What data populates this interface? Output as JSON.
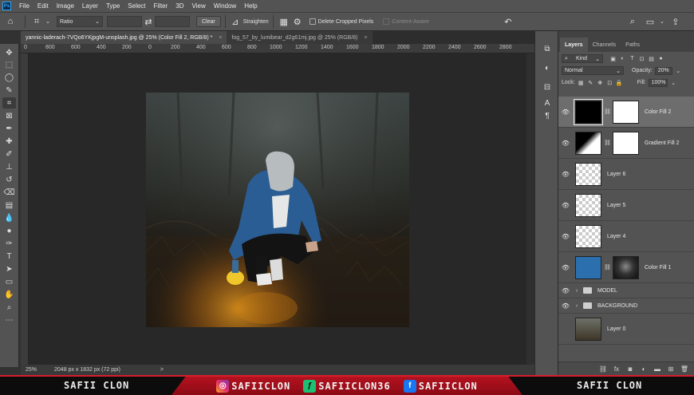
{
  "app": {
    "logo": "Ps"
  },
  "menu": [
    "File",
    "Edit",
    "Image",
    "Layer",
    "Type",
    "Select",
    "Filter",
    "3D",
    "View",
    "Window",
    "Help"
  ],
  "options_bar": {
    "ratio_label": "Ratio",
    "clear_label": "Clear",
    "straighten_label": "Straighten",
    "delete_cropped_label": "Delete Cropped Pixels",
    "content_aware_label": "Content-Aware"
  },
  "tabs": [
    {
      "label": "yannic-laderach-7VQo6YKjpgM-unsplash.jpg @ 25% (Color Fill 2, RGB/8) *",
      "close": "×"
    },
    {
      "label": "fog_57_by_lumibear_d2g61mj.jpg @ 25% (RGB/8)",
      "close": "×"
    }
  ],
  "ruler": [
    "0",
    "800",
    "600",
    "400",
    "200",
    "0",
    "200",
    "400",
    "600",
    "800",
    "1000",
    "1200",
    "1400",
    "1600",
    "1800",
    "2000",
    "2200",
    "2400",
    "2600",
    "2800"
  ],
  "status": {
    "zoom": "25%",
    "doc_info": "2048 px x 1832 px (72 ppi)",
    "arrow": ">"
  },
  "panel": {
    "tabs": [
      "Layers",
      "Channels",
      "Paths"
    ],
    "kind_label": "Kind",
    "blend_mode": "Normal",
    "opacity_label": "Opacity:",
    "opacity_value": "20%",
    "lock_label": "Lock:",
    "fill_label": "Fill:",
    "fill_value": "100%"
  },
  "layers": [
    {
      "name": "Color Fill 2"
    },
    {
      "name": "Gradient Fill 2"
    },
    {
      "name": "Layer 6"
    },
    {
      "name": "Layer 5"
    },
    {
      "name": "Layer 4"
    },
    {
      "name": "Color Fill 1"
    },
    {
      "name": "MODEL"
    },
    {
      "name": "BACKGROUND"
    },
    {
      "name": "Layer 0"
    }
  ],
  "banner": {
    "left_name": "SAFII CLON",
    "right_name": "SAFII CLON",
    "social": [
      {
        "icon": "instagram-icon",
        "handle": "SAFIICLON"
      },
      {
        "icon": "fiverr-icon",
        "handle": "SAFIICLON36"
      },
      {
        "icon": "facebook-icon",
        "handle": "SAFIICLON"
      }
    ]
  },
  "colors": {
    "foreground": "#f2b61d",
    "background": "#ffffff",
    "color_fill_1": "#2b6fae",
    "banner_red": "#b5121f"
  }
}
